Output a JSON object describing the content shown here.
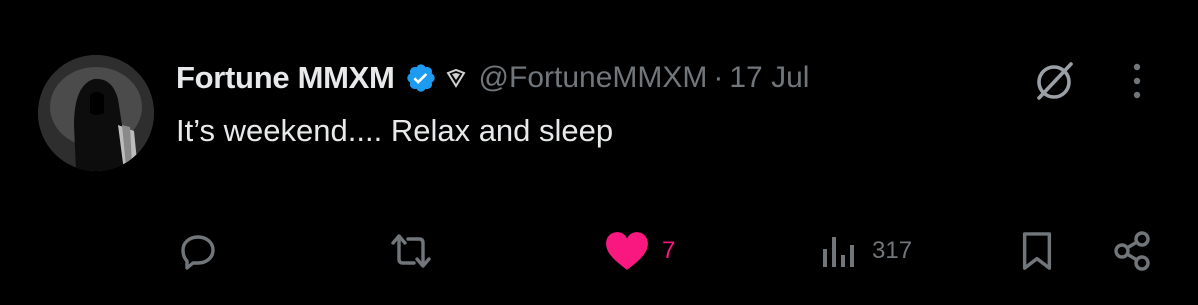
{
  "author": {
    "display_name": "Fortune MMXM",
    "handle": "@FortuneMMXM",
    "separator": "·",
    "timestamp": "17 Jul",
    "verified_color": "#1d9bf0",
    "avatar_icon": "hooded-figure-avatar"
  },
  "tweet": {
    "text": "It’s weekend.... Relax and sleep"
  },
  "header_actions": {
    "grok_icon": "grok-icon",
    "more_icon": "more-vertical-icon"
  },
  "actions": {
    "reply": {
      "icon": "reply-icon",
      "count": ""
    },
    "repost": {
      "icon": "repost-icon",
      "count": ""
    },
    "like": {
      "icon": "heart-filled-icon",
      "count": "7",
      "liked": true,
      "color": "#f91880"
    },
    "views": {
      "icon": "views-icon",
      "count": "317"
    },
    "bookmark": {
      "icon": "bookmark-icon"
    },
    "share": {
      "icon": "share-icon"
    }
  },
  "colors": {
    "background": "#000000",
    "primary_text": "#e7e9ea",
    "secondary_text": "#71767b",
    "like": "#f91880",
    "verified": "#1d9bf0"
  }
}
